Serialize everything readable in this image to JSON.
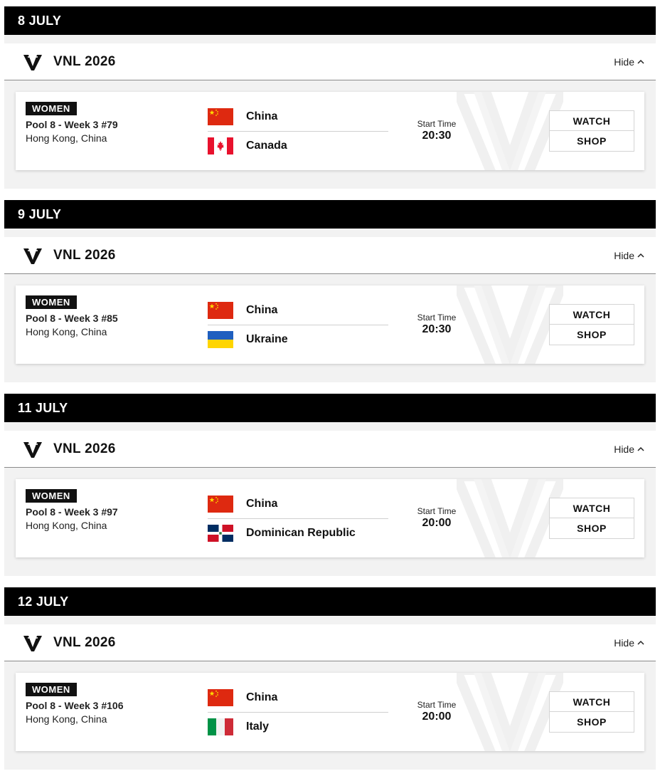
{
  "competition_name": "VNL 2026",
  "hide_label": "Hide",
  "start_time_label": "Start Time",
  "watch_label": "WATCH",
  "shop_label": "SHOP",
  "days": [
    {
      "date": "8 JULY",
      "match": {
        "gender": "WOMEN",
        "pool": "Pool 8 - Week 3 #79",
        "venue": "Hong Kong, China",
        "home": {
          "name": "China",
          "flag": "china-flag-icon"
        },
        "away": {
          "name": "Canada",
          "flag": "canada-flag-icon"
        },
        "time": "20:30"
      }
    },
    {
      "date": "9 JULY",
      "match": {
        "gender": "WOMEN",
        "pool": "Pool 8 - Week 3 #85",
        "venue": "Hong Kong, China",
        "home": {
          "name": "China",
          "flag": "china-flag-icon"
        },
        "away": {
          "name": "Ukraine",
          "flag": "ukraine-flag-icon"
        },
        "time": "20:30"
      }
    },
    {
      "date": "11 JULY",
      "match": {
        "gender": "WOMEN",
        "pool": "Pool 8 - Week 3 #97",
        "venue": "Hong Kong, China",
        "home": {
          "name": "China",
          "flag": "china-flag-icon"
        },
        "away": {
          "name": "Dominican Republic",
          "flag": "dominican-republic-flag-icon"
        },
        "time": "20:00"
      }
    },
    {
      "date": "12 JULY",
      "match": {
        "gender": "WOMEN",
        "pool": "Pool 8 - Week 3 #106",
        "venue": "Hong Kong, China",
        "home": {
          "name": "China",
          "flag": "china-flag-icon"
        },
        "away": {
          "name": "Italy",
          "flag": "italy-flag-icon"
        },
        "time": "20:00"
      }
    }
  ],
  "colors": {
    "date_bar": "#000000",
    "section_bg": "#f2f2f2",
    "badge_bg": "#111111"
  }
}
